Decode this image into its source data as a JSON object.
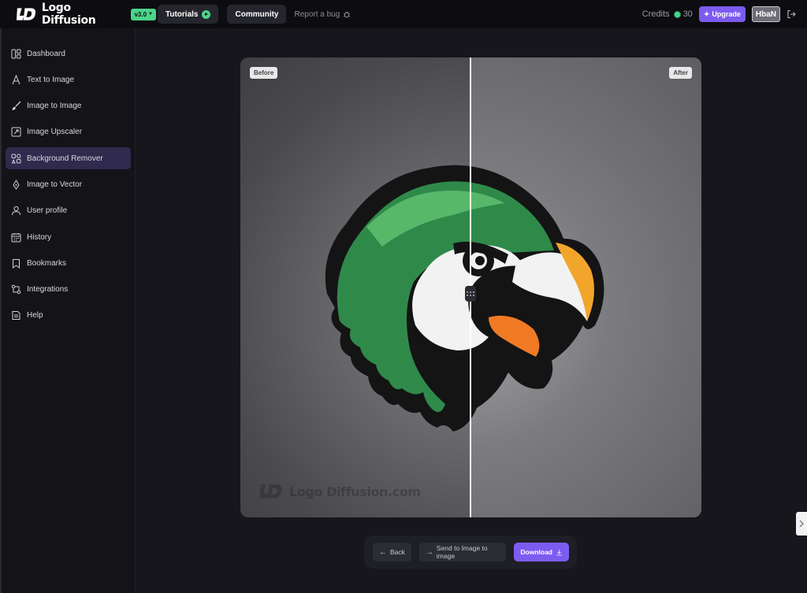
{
  "header": {
    "brand_name": "Logo Diffusion",
    "version": "v3.0",
    "nav": [
      {
        "label": "Tutorials"
      },
      {
        "label": "Community"
      }
    ],
    "report_label": "Report a bug",
    "credits_label": "Credits",
    "credits_value": "30",
    "upgrade_label": "Upgrade",
    "user": "HbaN"
  },
  "sidebar": {
    "items": [
      {
        "label": "Dashboard",
        "icon": "dashboard-icon"
      },
      {
        "label": "Text to Image",
        "icon": "text-icon"
      },
      {
        "label": "Image to Image",
        "icon": "brush-icon"
      },
      {
        "label": "Image Upscaler",
        "icon": "upscale-icon"
      },
      {
        "label": "Background Remover",
        "icon": "background-remover-icon",
        "active": true
      },
      {
        "label": "Image to Vector",
        "icon": "pen-nib-icon"
      },
      {
        "label": "User profile",
        "icon": "user-icon"
      },
      {
        "label": "History",
        "icon": "calendar-icon"
      },
      {
        "label": "Bookmarks",
        "icon": "bookmark-icon"
      },
      {
        "label": "Integrations",
        "icon": "integrations-icon"
      },
      {
        "label": "Help",
        "icon": "help-document-icon"
      }
    ]
  },
  "compare": {
    "before_label": "Before",
    "after_label": "After",
    "watermark": "Logo Diffusion.com"
  },
  "toolbar": {
    "back_label": "Back",
    "send_label": "Send to Image to image",
    "download_label": "Download"
  },
  "colors": {
    "accent": "#7c5cf0",
    "brand_green": "#4bd38a",
    "active_item": "#302a4e"
  }
}
